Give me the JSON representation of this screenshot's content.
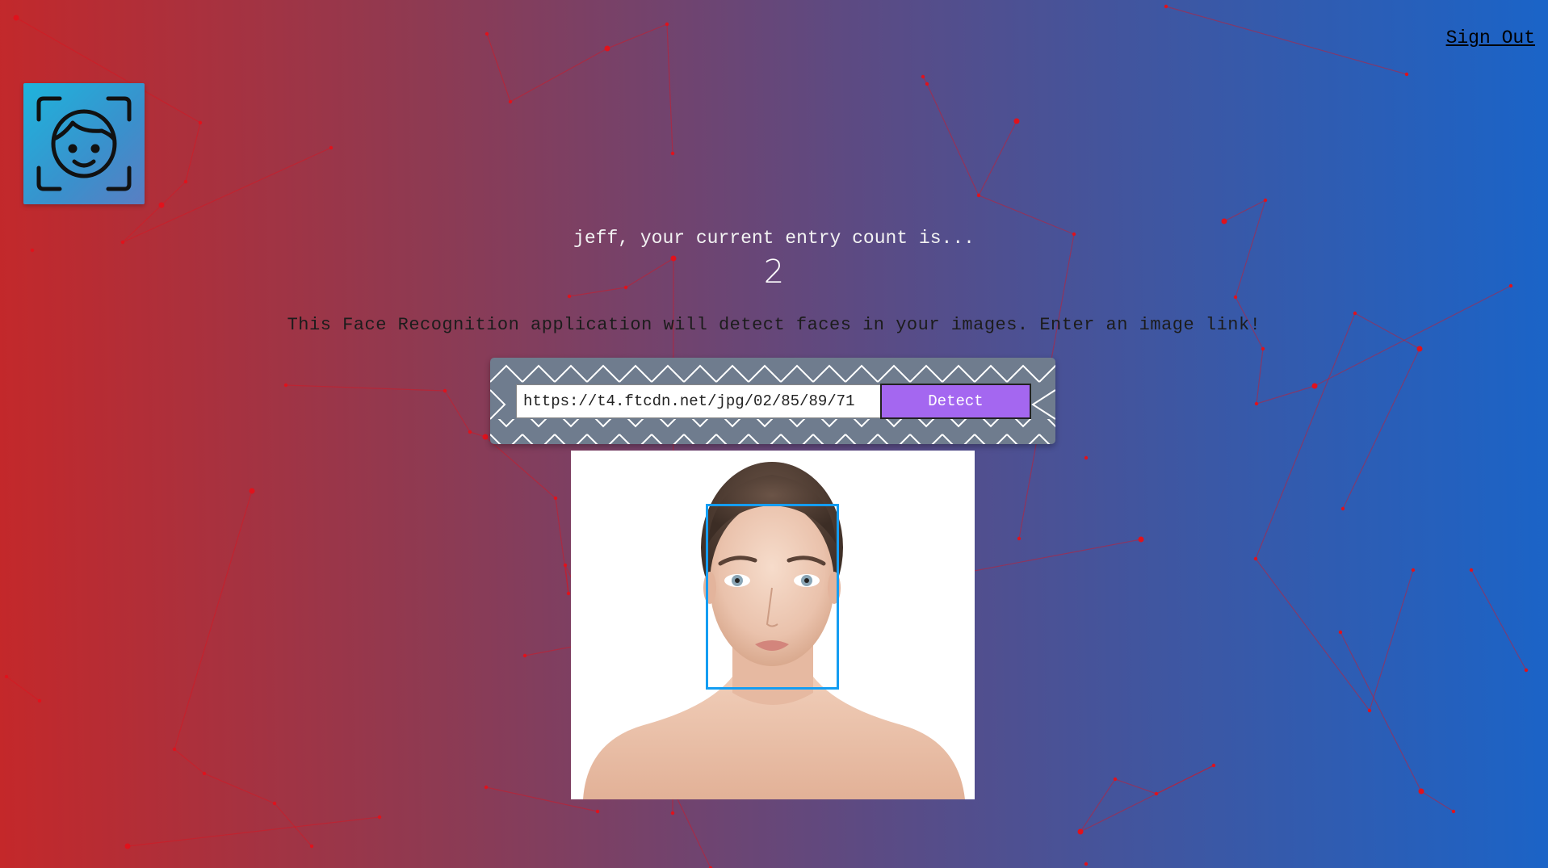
{
  "header": {
    "sign_out_label": "Sign Out"
  },
  "logo": {
    "icon": "face-scan-icon"
  },
  "rank": {
    "message": "jeff, your current entry count is...",
    "count": "2"
  },
  "intro": {
    "text": "This Face Recognition application will detect faces in your images. Enter an image link!"
  },
  "form": {
    "url_value": "https://t4.ftcdn.net/jpg/02/85/89/71",
    "button_label": "Detect"
  },
  "result": {
    "image_alt": "face photo",
    "faces_detected": 1
  },
  "colors": {
    "background_left": "#c4282a",
    "background_right": "#1a64c8",
    "button": "#a467f0",
    "box": "#149df2",
    "particle": "#e0121c"
  }
}
